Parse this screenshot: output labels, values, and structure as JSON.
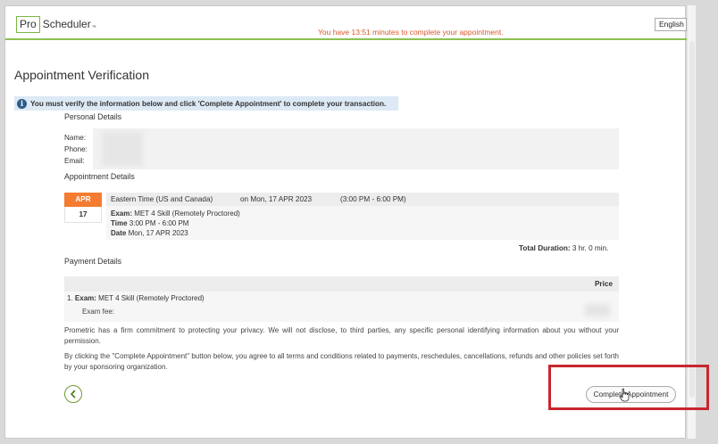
{
  "header": {
    "logo_pro": "Pro",
    "logo_scheduler": "Scheduler",
    "logo_tm": "™",
    "timer_text": "You have 13:51 minutes to complete your appointment.",
    "language": "English"
  },
  "page": {
    "title": "Appointment Verification",
    "alert_text": "You must verify the information below and click 'Complete Appointment' to complete your transaction.",
    "alert_icon": "info-icon"
  },
  "personal": {
    "title": "Personal Details",
    "name_label": "Name:",
    "phone_label": "Phone:",
    "email_label": "Email:"
  },
  "appointment": {
    "title": "Appointment Details",
    "month": "APR",
    "day": "17",
    "timezone": "Eastern Time (US and Canada)",
    "on_date": "on Mon, 17 APR 2023",
    "time_range": "(3:00 PM - 6:00 PM)",
    "exam_label": "Exam:",
    "exam_value": "MET 4 Skill (Remotely Proctored)",
    "time_label": "Time",
    "time_value": "3:00 PM - 6:00 PM",
    "date_label": "Date",
    "date_value": "Mon, 17 APR 2023",
    "total_label": "Total Duration:",
    "total_value": "3 hr. 0 min."
  },
  "payment": {
    "title": "Payment Details",
    "price_header": "Price",
    "item_prefix": "1.",
    "exam_label": "Exam:",
    "exam_value": "MET 4 Skill (Remotely Proctored)",
    "fee_label": "Exam fee:"
  },
  "legal": {
    "privacy": "Prometric has a firm commitment to protecting your privacy. We will not disclose, to third parties, any specific personal identifying information about you without your permission.",
    "terms": "By clicking the \"Complete Appointment\" button below, you agree to all terms and conditions related to payments, reschedules, cancellations, refunds and other policies set forth by your sponsoring organization."
  },
  "actions": {
    "back_icon": "chevron-left-icon",
    "complete_label": "Complete Appointment"
  },
  "colors": {
    "accent_green": "#8cc152",
    "timer_orange": "#d9582b",
    "month_orange": "#f47c30",
    "highlight_red": "#c8262e",
    "alert_blue": "#dde9f5"
  }
}
